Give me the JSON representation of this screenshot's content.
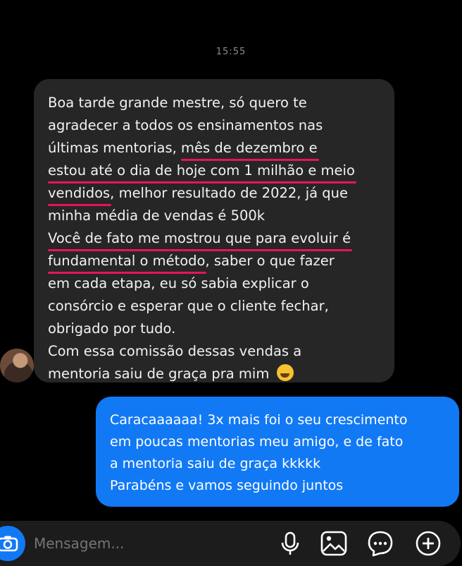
{
  "timestamp": "15:55",
  "incoming": {
    "lines": [
      {
        "parts": [
          {
            "t": "Boa tarde grande mestre, só quero te"
          }
        ]
      },
      {
        "parts": [
          {
            "t": "agradecer a todos os ensinamentos nas"
          }
        ]
      },
      {
        "parts": [
          {
            "t": "últimas mentorias, "
          },
          {
            "t": "mês de dezembro e",
            "hl": true
          }
        ]
      },
      {
        "parts": [
          {
            "t": "estou até o dia de hoje com 1 milhão e meio",
            "hl": true
          }
        ]
      },
      {
        "parts": [
          {
            "t": "vendidos",
            "hl": true
          },
          {
            "t": ", melhor resultado de 2022, já que"
          }
        ]
      },
      {
        "parts": [
          {
            "t": "minha média de vendas é 500k"
          }
        ]
      },
      {
        "parts": [
          {
            "t": "Você de fato me mostrou que para evoluir é",
            "hl": true
          }
        ]
      },
      {
        "parts": [
          {
            "t": "fundamental o método",
            "hl": true
          },
          {
            "t": ", saber o que fazer"
          }
        ]
      },
      {
        "parts": [
          {
            "t": "em cada etapa, eu só sabia explicar o"
          }
        ]
      },
      {
        "parts": [
          {
            "t": "consórcio e esperar que o cliente fechar,"
          }
        ]
      },
      {
        "parts": [
          {
            "t": "obrigado por tudo."
          }
        ]
      },
      {
        "parts": [
          {
            "t": "Com essa comissão dessas vendas a"
          }
        ]
      },
      {
        "parts": [
          {
            "t": "mentoria saiu de graça pra mim "
          }
        ],
        "emoji": "rolling-on-floor-laughing"
      }
    ],
    "highlight_color": "#e8145a",
    "bubble_color": "#262626"
  },
  "outgoing": {
    "lines": [
      "Caracaaaaaa! 3x mais foi o seu crescimento",
      "em poucas mentorias meu amigo, e de fato",
      "a mentoria saiu de graça kkkkk",
      "Parabéns e vamos seguindo juntos"
    ],
    "bubble_color": "#1279f5"
  },
  "composer": {
    "placeholder": "Mensagem...",
    "icons": [
      "camera-icon",
      "microphone-icon",
      "image-icon",
      "sticker-icon",
      "plus-icon"
    ]
  }
}
